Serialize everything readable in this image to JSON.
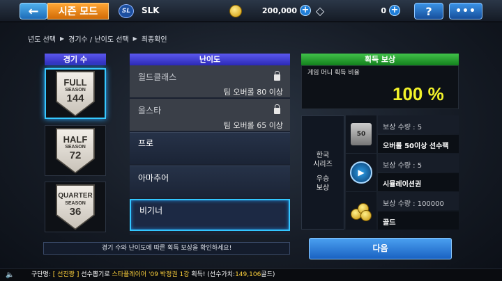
{
  "header": {
    "back_icon": "arrow-left-icon",
    "mode_title": "시즌 모드",
    "team_logo": "SL",
    "team_name": "SLK",
    "gold": "200,000",
    "gems": "0",
    "help_label": "?",
    "more_label": "•••"
  },
  "breadcrumb": {
    "step1": "년도 선택",
    "step2": "경기수 / 난이도 선택",
    "step3": "최종확인"
  },
  "games": {
    "header": "경기 수",
    "options": [
      {
        "big": "FULL",
        "sub": "SEASON",
        "num": "144"
      },
      {
        "big": "HALF",
        "sub": "SEASON",
        "num": "72"
      },
      {
        "big": "QUARTER",
        "sub": "SEASON",
        "num": "36"
      }
    ]
  },
  "difficulty": {
    "header": "난이도",
    "levels": [
      {
        "name": "월드클래스",
        "requirement": "팀 오버롤 80 이상"
      },
      {
        "name": "올스타",
        "requirement": "팀 오버롤 65 이상"
      },
      {
        "name": "프로"
      },
      {
        "name": "아마추어"
      },
      {
        "name": "비기너"
      }
    ]
  },
  "reward": {
    "header": "획득 보상",
    "rate_label": "게임 머니 획득 비율",
    "rate_value": "100 %",
    "series_line1": "한국",
    "series_line2": "시리즈",
    "series_line3": "우승",
    "series_line4": "보상",
    "items": [
      {
        "qty": "보상 수량 : 5",
        "name": "오버롤 50이상 선수팩",
        "icon": "player-pack-icon",
        "icon_text": "50"
      },
      {
        "qty": "보상 수량 : 5",
        "name": "시뮬레이션권",
        "icon": "simulation-ticket-icon",
        "icon_text": "▶"
      },
      {
        "qty": "보상 수량 : 100000",
        "name": "골드",
        "icon": "gold-coins-icon"
      }
    ]
  },
  "hint": "경기 수와 난이도에 따른 획득 보상을 확인하세요!",
  "next_label": "다음",
  "ticker": {
    "p1": "구단명:",
    "team": "[ 선진짱 ]",
    "p2": " 선수뽑기로 ",
    "player": "스타플레이어 '09 박정권 1강",
    "p3": " 획득! (선수가치:",
    "value": "149,106",
    "p4": "골드)"
  },
  "colors": {
    "accent_blue": "#2aa9ff",
    "header_purple": "#3b38d0",
    "header_green": "#1ea52a",
    "rate_yellow": "#f3f32a",
    "ticker_yellow": "#ffd23c"
  }
}
